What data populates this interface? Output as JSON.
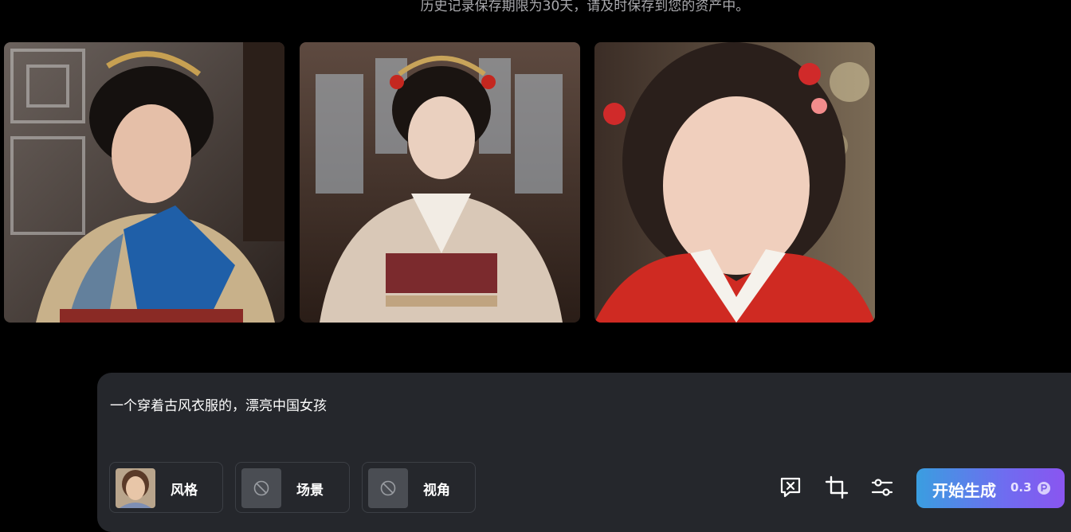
{
  "notice": "历史记录保存期限为30天，请及时保存到您的资产中。",
  "gallery": [
    {
      "alt": "blue-gold hanfu portrait"
    },
    {
      "alt": "beige hanfu portrait"
    },
    {
      "alt": "red hanfu close-up portrait"
    }
  ],
  "composer": {
    "prompt": "一个穿着古风衣服的，漂亮中国女孩",
    "chips": {
      "style": "风格",
      "scene": "场景",
      "angle": "视角"
    },
    "generate": {
      "label": "开始生成",
      "cost": "0.3"
    }
  },
  "colors": {
    "background": "#000000",
    "panel": "#25272c",
    "accent_start": "#3a9ee0",
    "accent_end": "#8a55f0"
  }
}
